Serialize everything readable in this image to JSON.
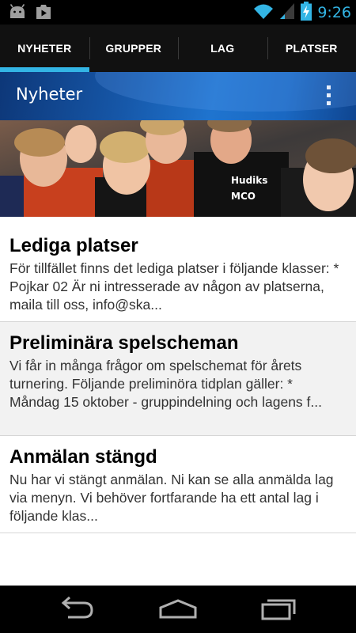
{
  "status_bar": {
    "time": "9:26",
    "left_icons": [
      "android-icon",
      "play-store-icon"
    ],
    "right_icons": [
      "wifi-icon",
      "signal-icon",
      "battery-charging-icon"
    ],
    "accent": "#33b5e5"
  },
  "tabs": [
    {
      "label": "NYHETER",
      "active": true
    },
    {
      "label": "GRUPPER",
      "active": false
    },
    {
      "label": "LAG",
      "active": false
    },
    {
      "label": "PLATSER",
      "active": false
    }
  ],
  "action_bar": {
    "title": "Nyheter",
    "menu_icon": "overflow-menu-icon",
    "colors": {
      "dark": "#0d3778",
      "light": "#1f74cf"
    }
  },
  "banner": {
    "image": "handball-team-celebration-photo"
  },
  "news": [
    {
      "title": "Lediga platser",
      "body": "För tillfället finns det lediga platser i följande klasser: * Pojkar 02 Är ni intresserade av någon av platserna, maila till oss, info@ska..."
    },
    {
      "title": "Preliminära spelscheman",
      "body": "Vi får in många frågor om spelschemat för årets turnering. Följande preliminöra tidplan gäller: * Måndag 15 oktober - gruppindelning och lagens f..."
    },
    {
      "title": "Anmälan stängd",
      "body": "Nu har vi stängt anmälan. Ni kan se alla anmälda lag via menyn. Vi behöver fortfarande ha ett antal lag i följande klas..."
    }
  ],
  "nav_bar": {
    "buttons": [
      "back-icon",
      "home-icon",
      "recent-apps-icon"
    ]
  }
}
